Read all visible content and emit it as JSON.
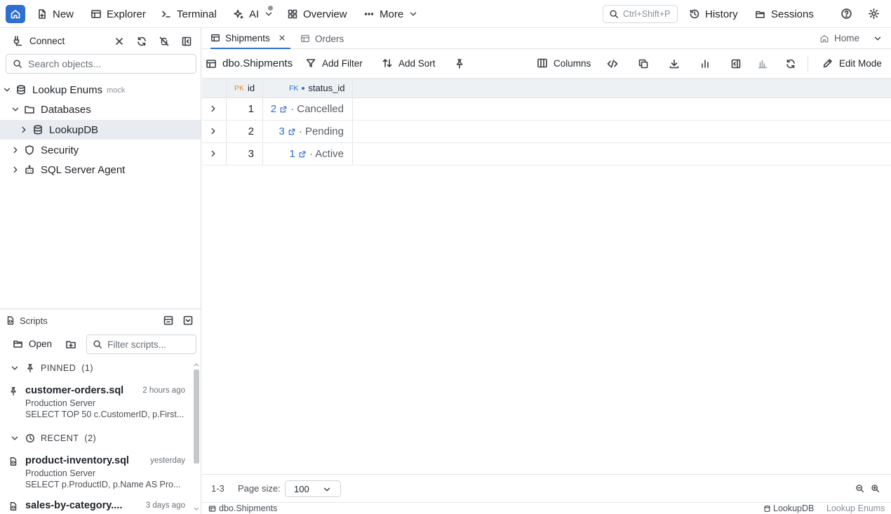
{
  "topbar": {
    "new_label": "New",
    "explorer_label": "Explorer",
    "terminal_label": "Terminal",
    "ai_label": "AI",
    "overview_label": "Overview",
    "more_label": "More",
    "search_placeholder": "Ctrl+Shift+P",
    "history_label": "History",
    "sessions_label": "Sessions"
  },
  "sidebar": {
    "connect_label": "Connect",
    "search_placeholder": "Search objects...",
    "tree": {
      "connection_name": "Lookup Enums",
      "connection_badge": "mock",
      "databases_label": "Databases",
      "db_name": "LookupDB",
      "security_label": "Security",
      "agent_label": "SQL Server Agent"
    }
  },
  "scripts": {
    "title": "Scripts",
    "open_label": "Open",
    "filter_placeholder": "Filter scripts...",
    "pinned_label": "PINNED",
    "pinned_count": "(1)",
    "recent_label": "RECENT",
    "recent_count": "(2)",
    "items": [
      {
        "name": "customer-orders.sql",
        "when": "2 hours ago",
        "server": "Production Server",
        "sql": "SELECT TOP 50 c.CustomerID, p.First..."
      },
      {
        "name": "product-inventory.sql",
        "when": "yesterday",
        "server": "Production Server",
        "sql": "SELECT p.ProductID, p.Name AS Pro..."
      },
      {
        "name": "sales-by-category....",
        "when": "3 days ago"
      }
    ]
  },
  "tabs": {
    "items": [
      {
        "label": "Shipments"
      },
      {
        "label": "Orders"
      }
    ],
    "home_label": "Home"
  },
  "toolbar": {
    "table_name": "dbo.Shipments",
    "add_filter": "Add Filter",
    "add_sort": "Add Sort",
    "columns": "Columns",
    "edit_mode": "Edit Mode"
  },
  "grid": {
    "columns": [
      {
        "badge": "PK",
        "name": "id"
      },
      {
        "badge": "FK",
        "name": "status_id"
      }
    ],
    "rows": [
      {
        "id": "1",
        "fk": "2",
        "lookup": "· Cancelled"
      },
      {
        "id": "2",
        "fk": "3",
        "lookup": "· Pending"
      },
      {
        "id": "3",
        "fk": "1",
        "lookup": "· Active"
      }
    ]
  },
  "pager": {
    "range": "1-3",
    "page_size_label": "Page size:",
    "page_size_value": "100"
  },
  "status": {
    "table": "dbo.Shipments",
    "database": "LookupDB",
    "connection": "Lookup Enums"
  },
  "colors": {
    "accent": "#2f6fd0",
    "pk_badge": "#e0892b",
    "fk_badge": "#2f6fd0"
  }
}
